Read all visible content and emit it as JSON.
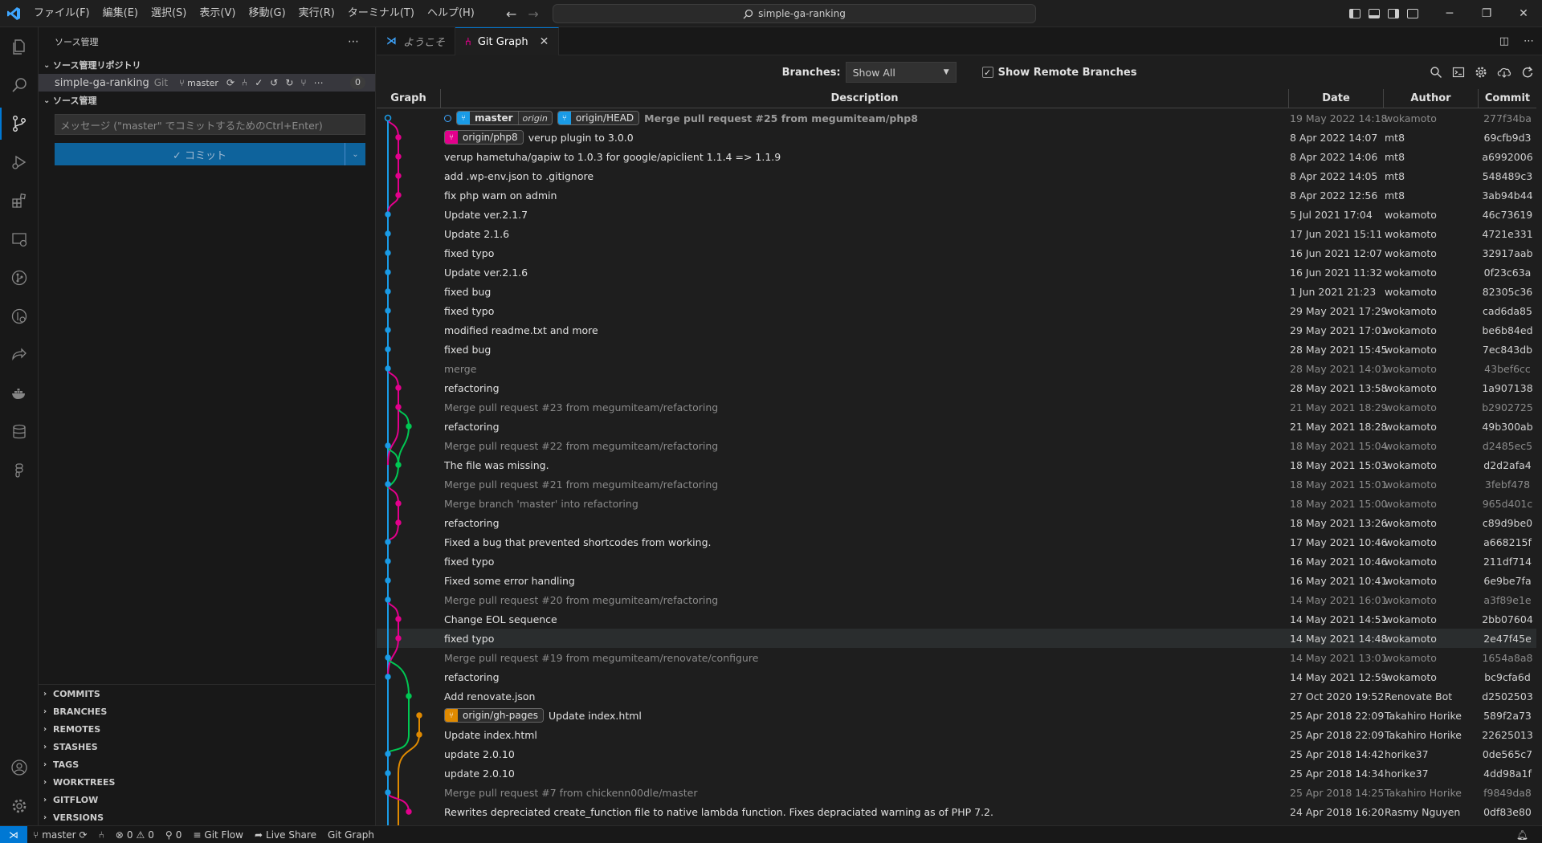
{
  "titlebar": {
    "menu": [
      "ファイル(F)",
      "編集(E)",
      "選択(S)",
      "表示(V)",
      "移動(G)",
      "実行(R)",
      "ターミナル(T)",
      "ヘルプ(H)"
    ],
    "search": "simple-ga-ranking"
  },
  "sidebar": {
    "title": "ソース管理",
    "repos_section": "ソース管理リポジトリ",
    "repo_name": "simple-ga-ranking",
    "repo_type": "Git",
    "repo_branch": "master",
    "repo_badge": "0",
    "scm_section": "ソース管理",
    "message_placeholder": "メッセージ (\"master\" でコミットするためのCtrl+Enter)",
    "commit_label": "✓ コミット",
    "lower_sections": [
      "COMMITS",
      "BRANCHES",
      "REMOTES",
      "STASHES",
      "TAGS",
      "WORKTREES",
      "GITFLOW",
      "VERSIONS"
    ]
  },
  "tabs": [
    {
      "label": "ようこそ",
      "active": false
    },
    {
      "label": "Git Graph",
      "active": true
    }
  ],
  "gitgraph": {
    "branches_label": "Branches:",
    "branches_value": "Show All",
    "show_remote_label": "Show Remote Branches",
    "columns": {
      "graph": "Graph",
      "description": "Description",
      "date": "Date",
      "author": "Author",
      "commit": "Commit"
    },
    "colors": {
      "blue": "#1a9be6",
      "magenta": "#e3008c",
      "green": "#00c853",
      "orange": "#e08a00"
    },
    "rows": [
      {
        "msg": "Merge pull request #25 from megumiteam/php8",
        "date": "19 May 2022 14:18",
        "author": "wokamoto",
        "hash": "277f34ba",
        "merge": true,
        "head": true,
        "refs": [
          {
            "name": "master",
            "remote": "origin",
            "color": "#1a9be6"
          },
          {
            "name": "origin/HEAD",
            "color": "#1a9be6"
          }
        ]
      },
      {
        "msg": "verup plugin to 3.0.0",
        "date": "8 Apr 2022 14:07",
        "author": "mt8",
        "hash": "69cfb9d3",
        "refs": [
          {
            "name": "origin/php8",
            "color": "#e3008c"
          }
        ]
      },
      {
        "msg": "verup hametuha/gapiw to 1.0.3 for google/apiclient 1.1.4 => 1.1.9",
        "date": "8 Apr 2022 14:06",
        "author": "mt8",
        "hash": "a6992006"
      },
      {
        "msg": "add .wp-env.json to .gitignore",
        "date": "8 Apr 2022 14:05",
        "author": "mt8",
        "hash": "548489c3"
      },
      {
        "msg": "fix php warn on admin",
        "date": "8 Apr 2022 12:56",
        "author": "mt8",
        "hash": "3ab94b44"
      },
      {
        "msg": "Update ver.2.1.7",
        "date": "5 Jul 2021 17:04",
        "author": "wokamoto",
        "hash": "46c73619"
      },
      {
        "msg": "Update 2.1.6",
        "date": "17 Jun 2021 15:11",
        "author": "wokamoto",
        "hash": "4721e331"
      },
      {
        "msg": "fixed typo",
        "date": "16 Jun 2021 12:07",
        "author": "wokamoto",
        "hash": "32917aab"
      },
      {
        "msg": "Update ver.2.1.6",
        "date": "16 Jun 2021 11:32",
        "author": "wokamoto",
        "hash": "0f23c63a"
      },
      {
        "msg": "fixed bug",
        "date": "1 Jun 2021 21:23",
        "author": "wokamoto",
        "hash": "82305c36"
      },
      {
        "msg": "fixed typo",
        "date": "29 May 2021 17:29",
        "author": "wokamoto",
        "hash": "cad6da85"
      },
      {
        "msg": "modified readme.txt and more",
        "date": "29 May 2021 17:01",
        "author": "wokamoto",
        "hash": "be6b84ed"
      },
      {
        "msg": "fixed bug",
        "date": "28 May 2021 15:45",
        "author": "wokamoto",
        "hash": "7ec843db"
      },
      {
        "msg": "merge",
        "date": "28 May 2021 14:01",
        "author": "wokamoto",
        "hash": "43bef6cc",
        "merge": true
      },
      {
        "msg": "refactoring",
        "date": "28 May 2021 13:58",
        "author": "wokamoto",
        "hash": "1a907138"
      },
      {
        "msg": "Merge pull request #23 from megumiteam/refactoring",
        "date": "21 May 2021 18:29",
        "author": "wokamoto",
        "hash": "b2902725",
        "merge": true
      },
      {
        "msg": "refactoring",
        "date": "21 May 2021 18:28",
        "author": "wokamoto",
        "hash": "49b300ab"
      },
      {
        "msg": "Merge pull request #22 from megumiteam/refactoring",
        "date": "18 May 2021 15:04",
        "author": "wokamoto",
        "hash": "d2485ec5",
        "merge": true
      },
      {
        "msg": "The file was missing.",
        "date": "18 May 2021 15:03",
        "author": "wokamoto",
        "hash": "d2d2afa4"
      },
      {
        "msg": "Merge pull request #21 from megumiteam/refactoring",
        "date": "18 May 2021 15:01",
        "author": "wokamoto",
        "hash": "3febf478",
        "merge": true
      },
      {
        "msg": "Merge branch 'master' into refactoring",
        "date": "18 May 2021 15:00",
        "author": "wokamoto",
        "hash": "965d401c",
        "merge": true
      },
      {
        "msg": "refactoring",
        "date": "18 May 2021 13:26",
        "author": "wokamoto",
        "hash": "c89d9be0"
      },
      {
        "msg": "Fixed a bug that prevented shortcodes from working.",
        "date": "17 May 2021 10:46",
        "author": "wokamoto",
        "hash": "a668215f"
      },
      {
        "msg": "fixed typo",
        "date": "16 May 2021 10:46",
        "author": "wokamoto",
        "hash": "211df714"
      },
      {
        "msg": "Fixed some error handling",
        "date": "16 May 2021 10:41",
        "author": "wokamoto",
        "hash": "6e9be7fa"
      },
      {
        "msg": "Merge pull request #20 from megumiteam/refactoring",
        "date": "14 May 2021 16:01",
        "author": "wokamoto",
        "hash": "a3f89e1e",
        "merge": true
      },
      {
        "msg": "Change EOL sequence",
        "date": "14 May 2021 14:51",
        "author": "wokamoto",
        "hash": "2bb07604"
      },
      {
        "msg": "fixed typo",
        "date": "14 May 2021 14:48",
        "author": "wokamoto",
        "hash": "2e47f45e",
        "selected": true
      },
      {
        "msg": "Merge pull request #19 from megumiteam/renovate/configure",
        "date": "14 May 2021 13:01",
        "author": "wokamoto",
        "hash": "1654a8a8",
        "merge": true
      },
      {
        "msg": "refactoring",
        "date": "14 May 2021 12:59",
        "author": "wokamoto",
        "hash": "bc9cfa6d"
      },
      {
        "msg": "Add renovate.json",
        "date": "27 Oct 2020 19:52",
        "author": "Renovate Bot",
        "hash": "d2502503"
      },
      {
        "msg": "Update index.html",
        "date": "25 Apr 2018 22:09",
        "author": "Takahiro Horike",
        "hash": "589f2a73",
        "refs": [
          {
            "name": "origin/gh-pages",
            "color": "#e08a00"
          }
        ]
      },
      {
        "msg": "Update index.html",
        "date": "25 Apr 2018 22:09",
        "author": "Takahiro Horike",
        "hash": "22625013"
      },
      {
        "msg": "update 2.0.10",
        "date": "25 Apr 2018 14:42",
        "author": "horike37",
        "hash": "0de565c7"
      },
      {
        "msg": "update 2.0.10",
        "date": "25 Apr 2018 14:34",
        "author": "horike37",
        "hash": "4dd98a1f"
      },
      {
        "msg": "Merge pull request #7 from chickenn00dle/master",
        "date": "25 Apr 2018 14:25",
        "author": "Takahiro Horike",
        "hash": "f9849da8",
        "merge": true
      },
      {
        "msg": "Rewrites depreciated create_function file to native lambda function. Fixes depraciated warning as of PHP 7.2.",
        "date": "24 Apr 2018 16:20",
        "author": "Rasmy Nguyen",
        "hash": "0df83e80"
      }
    ]
  },
  "statusbar": {
    "branch": "master",
    "errors": "0",
    "warnings": "0",
    "ports": "0",
    "gitflow": "Git Flow",
    "liveshare": "Live Share",
    "gitgraph": "Git Graph"
  }
}
